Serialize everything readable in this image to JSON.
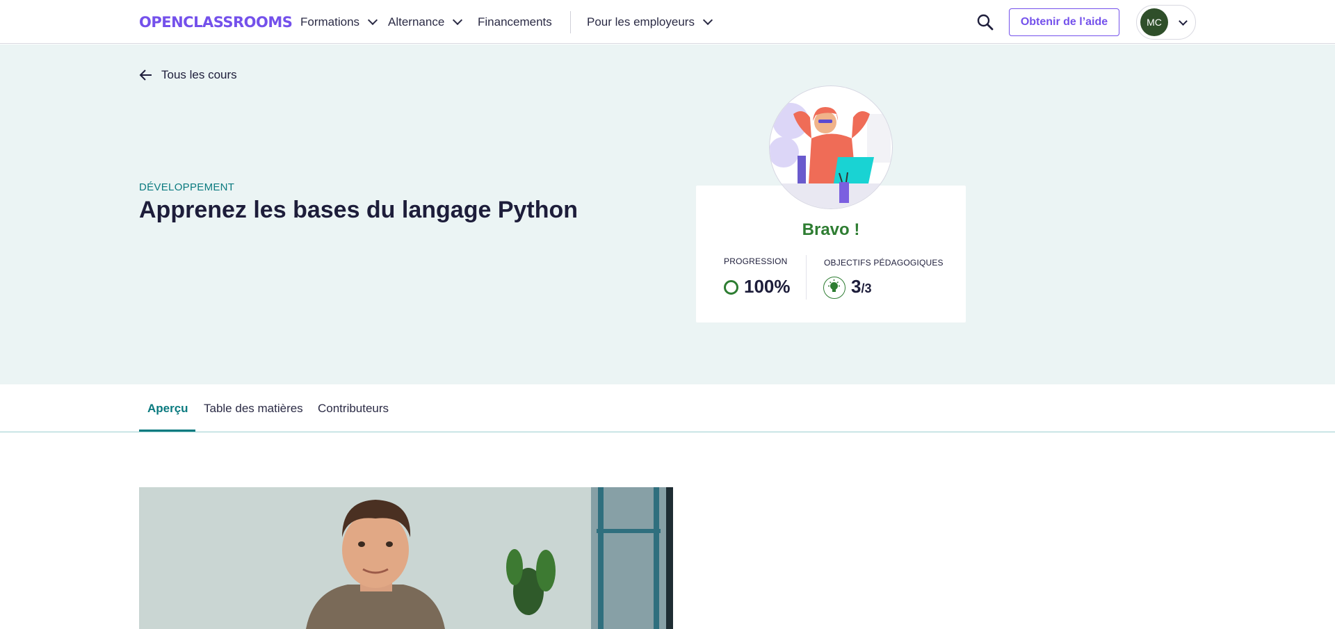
{
  "header": {
    "logo_text": "OPENCLASSROOMS",
    "nav": {
      "formations": "Formations",
      "alternance": "Alternance",
      "financements": "Financements",
      "employeurs": "Pour les employeurs"
    },
    "help_button": "Obtenir de l’aide",
    "user_initials": "MC",
    "icons": {
      "search": "search-icon",
      "chevron": "chevron-down-icon"
    }
  },
  "hero": {
    "back_label": "Tous les cours",
    "category": "DÉVELOPPEMENT",
    "title": "Apprenez les bases du langage Python",
    "card": {
      "headline": "Bravo !",
      "progress_label": "PROGRESSION",
      "progress_value": "100%",
      "progress_fraction": 1.0,
      "objectives_label": "OBJECTIFS PÉDAGOGIQUES",
      "objectives_done": "3",
      "objectives_total": "/3"
    }
  },
  "tabs": [
    {
      "label": "Aperçu",
      "active": true
    },
    {
      "label": "Table des matières",
      "active": false
    },
    {
      "label": "Contributeurs",
      "active": false
    }
  ],
  "colors": {
    "brand": "#7451eb",
    "accent_teal": "#0a7a7f",
    "success_green": "#2e7d32",
    "hero_bg": "#ebf4f4",
    "avatar_bg": "#2f4f2a"
  }
}
